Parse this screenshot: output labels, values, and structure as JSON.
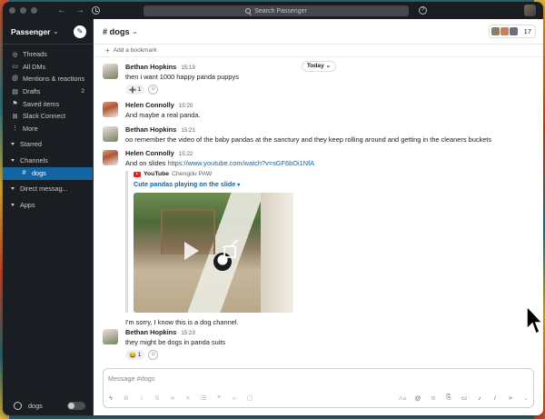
{
  "titlebar": {
    "search_placeholder": "Search Passenger"
  },
  "sidebar": {
    "workspace": "Passenger",
    "items": [
      {
        "label": "Threads",
        "icon": "threads-icon",
        "glyph": "◎"
      },
      {
        "label": "All DMs",
        "icon": "dms-icon",
        "glyph": "▭"
      },
      {
        "label": "Mentions & reactions",
        "icon": "at-icon",
        "glyph": "@"
      },
      {
        "label": "Drafts",
        "icon": "drafts-icon",
        "glyph": "▤",
        "badge": "2"
      },
      {
        "label": "Saved items",
        "icon": "bookmark-icon",
        "glyph": "⚑"
      },
      {
        "label": "Slack Connect",
        "icon": "connect-icon",
        "glyph": "⊞"
      },
      {
        "label": "More",
        "icon": "more-icon",
        "glyph": "⋮"
      }
    ],
    "sections": {
      "starred": "Starred",
      "channels": "Channels",
      "direct": "Direct messag...",
      "apps": "Apps"
    },
    "active_channel": "dogs",
    "footer_label": "dogs"
  },
  "header": {
    "channel": "# dogs",
    "member_count": "17",
    "bookmark_label": "Add a bookmark"
  },
  "day_divider": "Today",
  "messages": [
    {
      "author": "Bethan Hopkins",
      "time": "15:19",
      "text": "then i want 1000 happy panda puppys",
      "reaction": {
        "emoji": "➕",
        "count": "1"
      }
    },
    {
      "author": "Helen Connolly",
      "time": "15:20",
      "text": "And maybe a real panda."
    },
    {
      "author": "Bethan Hopkins",
      "time": "15:21",
      "text": "oo remember the video of the baby pandas at the sanctury and they keep rolling around and getting in the cleaners buckets"
    },
    {
      "author": "Helen Connolly",
      "time": "15:22",
      "text": "And on slides ",
      "link": "https://www.youtube.com/watch?v=sGF6bOi1NfA",
      "unfurl": {
        "site": "YouTube",
        "channel": "Chengdu PAW",
        "title": "Cute pandas playing on the slide"
      },
      "followup": "I'm sorry, I know this is a dog channel."
    },
    {
      "author": "Bethan Hopkins",
      "time": "15:23",
      "text": "they might be dogs in panda suits",
      "reaction": {
        "emoji": "😂",
        "count": "1"
      }
    }
  ],
  "composer": {
    "placeholder": "Message #dogs",
    "aa": "Aa",
    "at": "@"
  },
  "colors": {
    "sidebar_bg": "#1a1d21",
    "active_channel_bg": "#1264a3",
    "link": "#1264a3"
  }
}
